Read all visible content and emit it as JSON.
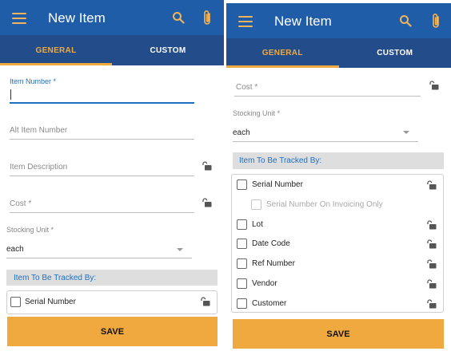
{
  "left_screen": {
    "app_bar": {
      "title": "New Item",
      "icons": [
        "menu-icon",
        "search-icon",
        "paperclip-icon"
      ]
    },
    "tabs": [
      {
        "label": "GENERAL",
        "active": true
      },
      {
        "label": "CUSTOM",
        "active": false
      }
    ],
    "fields": {
      "item_number": {
        "label": "Item Number *",
        "value": ""
      },
      "alt_item_number": {
        "placeholder": "Alt Item Number"
      },
      "item_description": {
        "placeholder": "Item Description"
      },
      "cost": {
        "placeholder": "Cost *"
      },
      "stocking_unit": {
        "label": "Stocking Unit *",
        "value": "each"
      }
    },
    "tracked_by": {
      "heading": "Item To Be Tracked By:",
      "items": [
        {
          "label": "Serial Number",
          "checked": false
        }
      ]
    },
    "save_label": "SAVE"
  },
  "right_screen": {
    "app_bar": {
      "title": "New Item",
      "icons": [
        "menu-icon",
        "search-icon",
        "paperclip-icon"
      ]
    },
    "tabs": [
      {
        "label": "GENERAL",
        "active": true
      },
      {
        "label": "CUSTOM",
        "active": false
      }
    ],
    "fields": {
      "cost": {
        "placeholder": "Cost *"
      },
      "stocking_unit": {
        "label": "Stocking Unit *",
        "value": "each"
      }
    },
    "tracked_by": {
      "heading": "Item To Be Tracked By:",
      "items": [
        {
          "label": "Serial Number",
          "checked": false,
          "enabled": true
        },
        {
          "label": "Serial Number On Invoicing Only",
          "checked": false,
          "enabled": false
        },
        {
          "label": "Lot",
          "checked": false,
          "enabled": true
        },
        {
          "label": "Date Code",
          "checked": false,
          "enabled": true
        },
        {
          "label": "Ref Number",
          "checked": false,
          "enabled": true
        },
        {
          "label": "Vendor",
          "checked": false,
          "enabled": true
        },
        {
          "label": "Customer",
          "checked": false,
          "enabled": true
        }
      ]
    },
    "save_label": "SAVE"
  },
  "colors": {
    "app_bar": "#1f5da8",
    "tab_bar": "#234c8a",
    "accent": "#f0a93e",
    "link_blue": "#1f6fc1"
  }
}
